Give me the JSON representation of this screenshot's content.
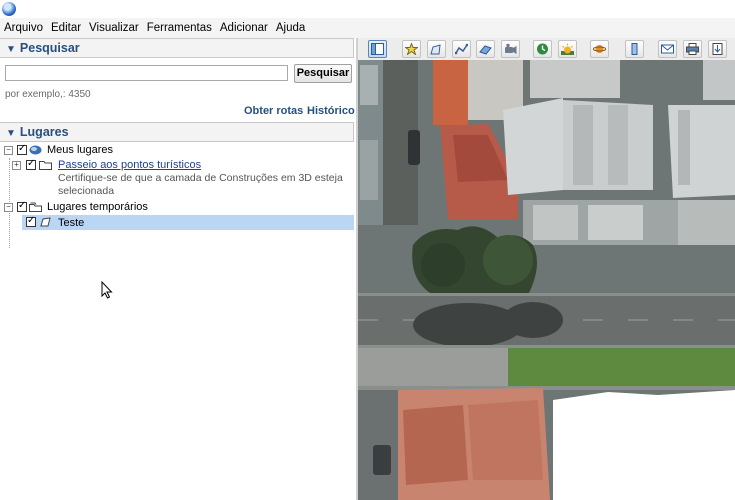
{
  "menu": [
    "Arquivo",
    "Editar",
    "Visualizar",
    "Ferramentas",
    "Adicionar",
    "Ajuda"
  ],
  "search": {
    "title": "Pesquisar",
    "input_value": "",
    "button_label": "Pesquisar",
    "hint": "por exemplo,: 4350",
    "link_routes": "Obter rotas",
    "link_history": "Histórico"
  },
  "places": {
    "title": "Lugares",
    "my_places": "Meus lugares",
    "tour_link": "Passeio aos pontos turísticos",
    "tour_desc": "Certifique-se de que a camada de Construções em 3D esteja selecionada",
    "temporary": "Lugares temporários",
    "selected_item": "Teste"
  },
  "toolbar_icons": [
    "sidebar-toggle-icon",
    "add-placemark-icon",
    "add-polygon-icon",
    "add-path-icon",
    "add-image-overlay-icon",
    "record-tour-icon",
    "historical-imagery-icon",
    "sunlight-icon",
    "planets-icon",
    "ruler-icon",
    "email-icon",
    "print-icon",
    "save-image-icon"
  ],
  "colors": {
    "accent": "#27507f",
    "selection": "#b9d7f5",
    "link": "#1f3f8f"
  }
}
